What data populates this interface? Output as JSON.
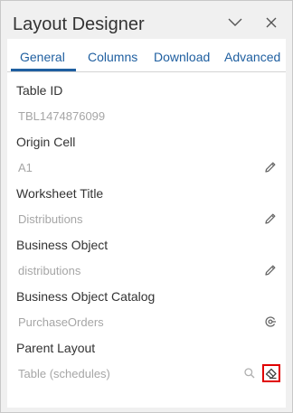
{
  "panel": {
    "title": "Layout Designer",
    "collapse_icon": "chevron-down-icon",
    "close_icon": "close-icon"
  },
  "tabs": [
    {
      "label": "General",
      "active": true
    },
    {
      "label": "Columns",
      "active": false
    },
    {
      "label": "Download",
      "active": false
    },
    {
      "label": "Advanced",
      "active": false
    }
  ],
  "fields": {
    "table_id": {
      "label": "Table ID",
      "value": "TBL1474876099"
    },
    "origin_cell": {
      "label": "Origin Cell",
      "value": "A1",
      "action_icon": "pencil-icon"
    },
    "worksheet_title": {
      "label": "Worksheet Title",
      "value": "Distributions",
      "action_icon": "pencil-icon"
    },
    "business_object": {
      "label": "Business Object",
      "value": "distributions",
      "action_icon": "pencil-icon"
    },
    "business_object_catalog": {
      "label": "Business Object Catalog",
      "value": "PurchaseOrders",
      "action_icon": "target-icon"
    },
    "parent_layout": {
      "label": "Parent Layout",
      "value": "Table (schedules)",
      "action_icons": [
        "search-icon",
        "eraser-icon"
      ]
    }
  },
  "colors": {
    "accent": "#1f5fa0",
    "text": "#333333",
    "muted": "#a6a6a6",
    "panel_bg": "#f0f0f0",
    "highlight": "#e00000"
  }
}
